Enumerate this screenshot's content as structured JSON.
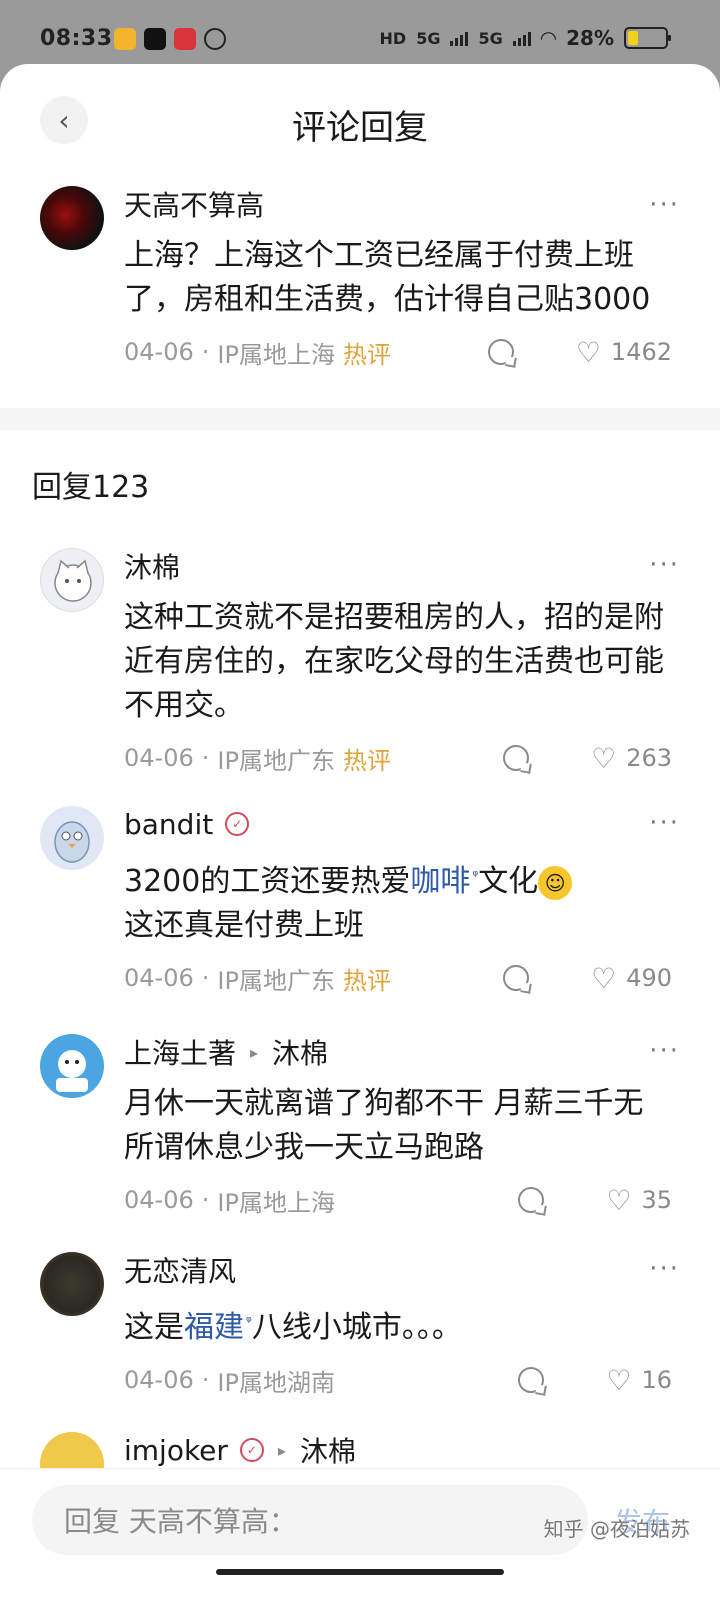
{
  "status_bar": {
    "time": "08:33",
    "network_1": "HD",
    "network_2": "5G",
    "network_3": "5G",
    "battery_percent": "28%",
    "battery_level": 0.28
  },
  "header": {
    "title": "评论回复"
  },
  "main_comment": {
    "author": "天高不算高",
    "text": "上海？上海这个工资已经属于付费上班了，房租和生活费，估计得自己贴3000",
    "date": "04-06",
    "ip": "IP属地上海",
    "hot_label": "热评",
    "likes": "1462",
    "more": "···"
  },
  "reply_count_label": "回复123",
  "replies": [
    {
      "author": "沐棉",
      "text": "这种工资就不是招要租房的人，招的是附近有房住的，在家吃父母的生活费也可能不用交。",
      "date": "04-06",
      "ip": "IP属地广东",
      "hot_label": "热评",
      "likes": "263",
      "more": "···"
    },
    {
      "author": "bandit",
      "text_part1": "3200的工资还要热爱",
      "tag": "咖啡",
      "text_part2": "文化",
      "text_part3": "这还真是付费上班",
      "date": "04-06",
      "ip": "IP属地广东",
      "hot_label": "热评",
      "likes": "490",
      "more": "···"
    },
    {
      "author": "上海土著",
      "reply_to": "沐棉",
      "text": "月休一天就离谱了狗都不干 月薪三千无所谓休息少我一天立马跑路",
      "date": "04-06",
      "ip": "IP属地上海",
      "likes": "35",
      "more": "···"
    },
    {
      "author": "无恋清风",
      "text_part1": "这是",
      "tag": "福建",
      "text_part2": "八线小城市。。。",
      "date": "04-06",
      "ip": "IP属地湖南",
      "likes": "16",
      "more": "···"
    },
    {
      "author": "imjoker",
      "reply_to": "沐棉"
    }
  ],
  "bottom": {
    "input_placeholder": "回复 天高不算高：",
    "publish_label": "发布",
    "watermark": "知乎 @夜泊姑苏"
  },
  "colors": {
    "accent_link": "#2f5aa8",
    "hot": "#e0a43a",
    "publish": "#aac4ea"
  }
}
